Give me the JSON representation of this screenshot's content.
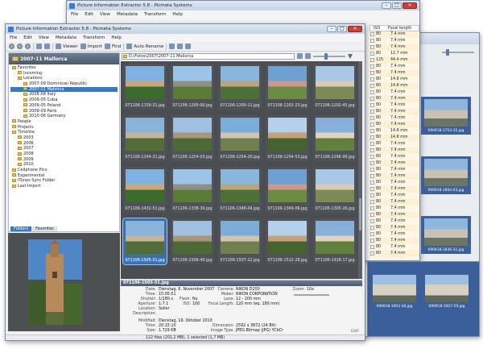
{
  "app_title": "Picture Information Extractor 5.8 - Picmeta Systems",
  "menu": [
    "File",
    "Edit",
    "View",
    "Metadata",
    "Transform",
    "Help"
  ],
  "toolbar": {
    "viewer": "Viewer",
    "import": "Import",
    "find": "Find",
    "auto_rename": "Auto Rename"
  },
  "path": "D:\\Fotos\\2007\\2007-11 Mallorca",
  "folder_title": "2007-11 Mallorca",
  "tree": [
    {
      "label": "Favorites",
      "level": 0
    },
    {
      "label": "Incoming",
      "level": 1
    },
    {
      "label": "Locations",
      "level": 1
    },
    {
      "label": "2007-09 Dominican Republic",
      "level": 2
    },
    {
      "label": "2007-11 Mallorca",
      "level": 2,
      "selected": true
    },
    {
      "label": "2008-08 Italy",
      "level": 2
    },
    {
      "label": "2009-05 Cuba",
      "level": 2
    },
    {
      "label": "2009-05 Poland",
      "level": 2
    },
    {
      "label": "2009-09 Paris",
      "level": 2
    },
    {
      "label": "2010-06 Germany",
      "level": 2
    },
    {
      "label": "People",
      "level": 0
    },
    {
      "label": "Projects",
      "level": 0
    },
    {
      "label": "Timeline",
      "level": 0
    },
    {
      "label": "2003",
      "level": 1
    },
    {
      "label": "2006",
      "level": 1
    },
    {
      "label": "2007",
      "level": 1
    },
    {
      "label": "2008",
      "level": 1
    },
    {
      "label": "2009",
      "level": 1
    },
    {
      "label": "2010",
      "level": 1
    },
    {
      "label": "Cellphone Pics",
      "level": 0
    },
    {
      "label": "Experimental",
      "level": 0
    },
    {
      "label": "iTunes Sync Folder",
      "level": 0
    },
    {
      "label": "Last Import",
      "level": 0
    }
  ],
  "tabs": [
    "Folders",
    "Favorites"
  ],
  "thumbs": [
    "071106-1159-31.jpg",
    "071106-1200-00.jpg",
    "071106-1200-11.jpg",
    "071106-1202-23.jpg",
    "071106-1202-45.jpg",
    "071106-1244-31.jpg",
    "071106-1254-03.jpg",
    "071106-1254-20.jpg",
    "071106-1254-53.jpg",
    "071106-1296-00.jpg",
    "071106-1432-51.jpg",
    "071106-1338-39.jpg",
    "071106-1348-04.jpg",
    "071106-1349-06.jpg",
    "071106-1305-26.jpg",
    "071106-1505-51.jpg",
    "071106-1506-40.jpg",
    "071106-1507-22.jpg",
    "071106-1512-28.jpg",
    "071106-1428-17.jpg"
  ],
  "selected_file": "071106-1505-51.jpg",
  "info_left": [
    [
      "Date:",
      "Dienstag, 6. November 2007"
    ],
    [
      "Time:",
      "15:05:51"
    ],
    [
      "Shutter:",
      "1/180 s"
    ],
    [
      "Aperture:",
      "1:7.1"
    ],
    [
      "Location:",
      "Soller"
    ],
    [
      "Description:",
      ""
    ]
  ],
  "flash": {
    "k": "Flash:",
    "v": "No"
  },
  "iso": {
    "k": "ISO:",
    "v": "100"
  },
  "info_mid": [
    [
      "Camera:",
      "NIKON D200"
    ],
    [
      "Maker:",
      "NIKON CORPORATION"
    ],
    [
      "Lens:",
      "12 - 200 mm"
    ],
    [
      "Focal Length:",
      "120 mm (eq. 180 mm)"
    ]
  ],
  "zoom": {
    "k": "Zoom:",
    "v": "10x"
  },
  "modified": [
    [
      "Modified:",
      "Dienstag, 19. Oktober 2010"
    ],
    [
      "Time:",
      "20:15:10"
    ],
    [
      "Size:",
      "1.729 KB"
    ]
  ],
  "dim": [
    [
      "Dimension:",
      "2592 x 3872 (24 Bit)"
    ],
    [
      "Image Type:",
      "JPEG Bitmap (JPG) YCbCr"
    ]
  ],
  "exif": "EXIF",
  "status": "122 files (201,2 MB), 1 selected (1,7 MB)",
  "back_window": {
    "cols": {
      "iso": "ISO",
      "focal": "Focal length"
    },
    "rows": [
      [
        "80",
        "7.4 mm"
      ],
      [
        "80",
        "7.4 mm"
      ],
      [
        "80",
        "7.4 mm"
      ],
      [
        "80",
        "12.7 mm"
      ],
      [
        "125",
        "44.4 mm"
      ],
      [
        "80",
        "7.4 mm"
      ],
      [
        "80",
        "7.4 mm"
      ],
      [
        "80",
        "14.8 mm"
      ],
      [
        "80",
        "14.8 mm"
      ],
      [
        "80",
        "7.4 mm"
      ],
      [
        "80",
        "7.4 mm"
      ],
      [
        "80",
        "7.4 mm"
      ],
      [
        "80",
        "7.4 mm"
      ],
      [
        "80",
        "7.4 mm"
      ],
      [
        "80",
        "7.4 mm"
      ],
      [
        "80",
        "14.8 mm"
      ],
      [
        "80",
        "14.8 mm"
      ],
      [
        "80",
        "7.4 mm"
      ],
      [
        "80",
        "7.4 mm"
      ],
      [
        "80",
        "7.4 mm"
      ],
      [
        "80",
        "7.4 mm"
      ],
      [
        "80",
        "7.4 mm"
      ],
      [
        "80",
        "7.4 mm"
      ],
      [
        "80",
        "7.4 mm"
      ],
      [
        "80",
        "7.4 mm"
      ],
      [
        "80",
        "7.4 mm"
      ],
      [
        "80",
        "7.4 mm"
      ],
      [
        "80",
        "7.4 mm"
      ],
      [
        "80",
        "7.4 mm"
      ],
      [
        "80",
        "7.4 mm"
      ],
      [
        "80",
        "7.4 mm"
      ],
      [
        "80",
        "7.4 mm"
      ],
      [
        "80",
        "7.4 mm"
      ],
      [
        "80",
        "7.4 mm"
      ],
      [
        "80",
        "7.4 mm"
      ]
    ],
    "thumbs": [
      "090918-1753-35.jpg",
      "090918-1804-03.jpg",
      "090918-1836-31.jpg"
    ],
    "bottom_thumbs": [
      "090918-1903-36.jpg",
      "090918-1927-59.jpg"
    ]
  },
  "colors": {
    "accent": "#3a78c6",
    "grid_bg": "#4a4d51"
  }
}
